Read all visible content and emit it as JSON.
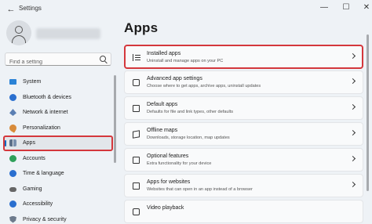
{
  "window": {
    "title": "Settings",
    "back_glyph": "←",
    "minimize_glyph": "—",
    "maximize_glyph": "☐",
    "close_glyph": "✕"
  },
  "sidebar": {
    "search_placeholder": "Find a setting",
    "items": [
      {
        "label": "System",
        "icon": "system-icon"
      },
      {
        "label": "Bluetooth & devices",
        "icon": "bluetooth-icon"
      },
      {
        "label": "Network & internet",
        "icon": "network-icon"
      },
      {
        "label": "Personalization",
        "icon": "personalization-icon"
      },
      {
        "label": "Apps",
        "icon": "apps-icon",
        "selected": true
      },
      {
        "label": "Accounts",
        "icon": "accounts-icon"
      },
      {
        "label": "Time & language",
        "icon": "time-icon"
      },
      {
        "label": "Gaming",
        "icon": "gaming-icon"
      },
      {
        "label": "Accessibility",
        "icon": "accessibility-icon"
      },
      {
        "label": "Privacy & security",
        "icon": "privacy-icon"
      }
    ]
  },
  "main": {
    "title": "Apps",
    "cards": [
      {
        "title": "Installed apps",
        "desc": "Uninstall and manage apps on your PC",
        "icon": "installed-apps-icon",
        "highlighted": true
      },
      {
        "title": "Advanced app settings",
        "desc": "Choose where to get apps, archive apps, uninstall updates",
        "icon": "advanced-settings-icon"
      },
      {
        "title": "Default apps",
        "desc": "Defaults for file and link types, other defaults",
        "icon": "default-apps-icon"
      },
      {
        "title": "Offline maps",
        "desc": "Downloads, storage location, map updates",
        "icon": "offline-maps-icon"
      },
      {
        "title": "Optional features",
        "desc": "Extra functionality for your device",
        "icon": "optional-features-icon"
      },
      {
        "title": "Apps for websites",
        "desc": "Websites that can open in an app instead of a browser",
        "icon": "apps-for-websites-icon"
      },
      {
        "title": "Video playback",
        "desc": "",
        "icon": "video-playback-icon"
      }
    ]
  },
  "colors": {
    "highlight": "#d4373c",
    "accent": "#0067c0",
    "background": "#eef2f6"
  }
}
